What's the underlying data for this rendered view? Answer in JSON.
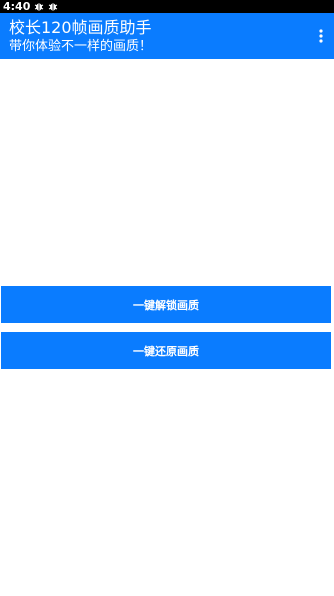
{
  "status_bar": {
    "time": "4:40",
    "notification_icons": [
      "bug-icon",
      "bug-icon"
    ]
  },
  "app_bar": {
    "title": "校长120帧画质助手",
    "subtitle": "带你体验不一样的画质！",
    "menu_icon": "more-vertical-icon",
    "background_color": "#0a7cff"
  },
  "actions": {
    "unlock_label": "一键解锁画质",
    "restore_label": "一键还原画质"
  },
  "colors": {
    "accent": "#0a7cff",
    "status_bar": "#000000",
    "background": "#ffffff"
  }
}
